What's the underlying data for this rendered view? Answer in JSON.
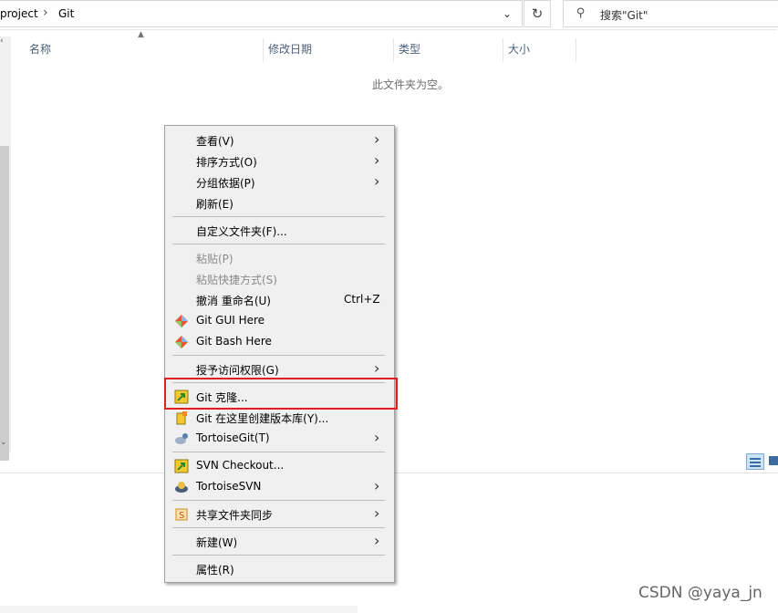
{
  "address": {
    "crumbs": [
      "project",
      "Git"
    ],
    "separator": "›",
    "dropdown_icon": "⌄",
    "refresh_icon": "↻"
  },
  "search": {
    "placeholder": "搜索\"Git\"",
    "icon": "search-icon"
  },
  "columns": [
    "名称",
    "修改日期",
    "类型",
    "大小"
  ],
  "empty_message": "此文件夹为空。",
  "context_menu": {
    "items": [
      {
        "label": "查看(V)",
        "submenu": true
      },
      {
        "label": "排序方式(O)",
        "submenu": true
      },
      {
        "label": "分组依据(P)",
        "submenu": true
      },
      {
        "label": "刷新(E)"
      },
      {
        "label": "自定义文件夹(F)..."
      },
      {
        "label": "粘贴(P)",
        "disabled": true
      },
      {
        "label": "粘贴快捷方式(S)",
        "disabled": true
      },
      {
        "label": "撤消 重命名(U)",
        "shortcut": "Ctrl+Z"
      },
      {
        "label": "Git GUI Here",
        "icon": "git-icon"
      },
      {
        "label": "Git Bash Here",
        "icon": "git-icon"
      },
      {
        "label": "授予访问权限(G)",
        "submenu": true
      },
      {
        "label": "Git 克隆...",
        "icon": "tortoisegit-clone-icon"
      },
      {
        "label": "Git 在这里创建版本库(Y)...",
        "icon": "tortoisegit-create-repo-icon"
      },
      {
        "label": "TortoiseGit(T)",
        "submenu": true,
        "icon": "tortoisegit-icon"
      },
      {
        "label": "SVN Checkout...",
        "icon": "svn-checkout-icon"
      },
      {
        "label": "TortoiseSVN",
        "submenu": true,
        "icon": "tortoisesvn-icon"
      },
      {
        "label": "共享文件夹同步",
        "submenu": true,
        "icon": "sync-icon"
      },
      {
        "label": "新建(W)",
        "submenu": true
      },
      {
        "label": "属性(R)"
      }
    ],
    "submenu_arrow": "›"
  },
  "watermark": "CSDN @yaya_jn",
  "colors": {
    "highlight_border": "#e02020",
    "menu_bg": "#f0f0f0"
  }
}
